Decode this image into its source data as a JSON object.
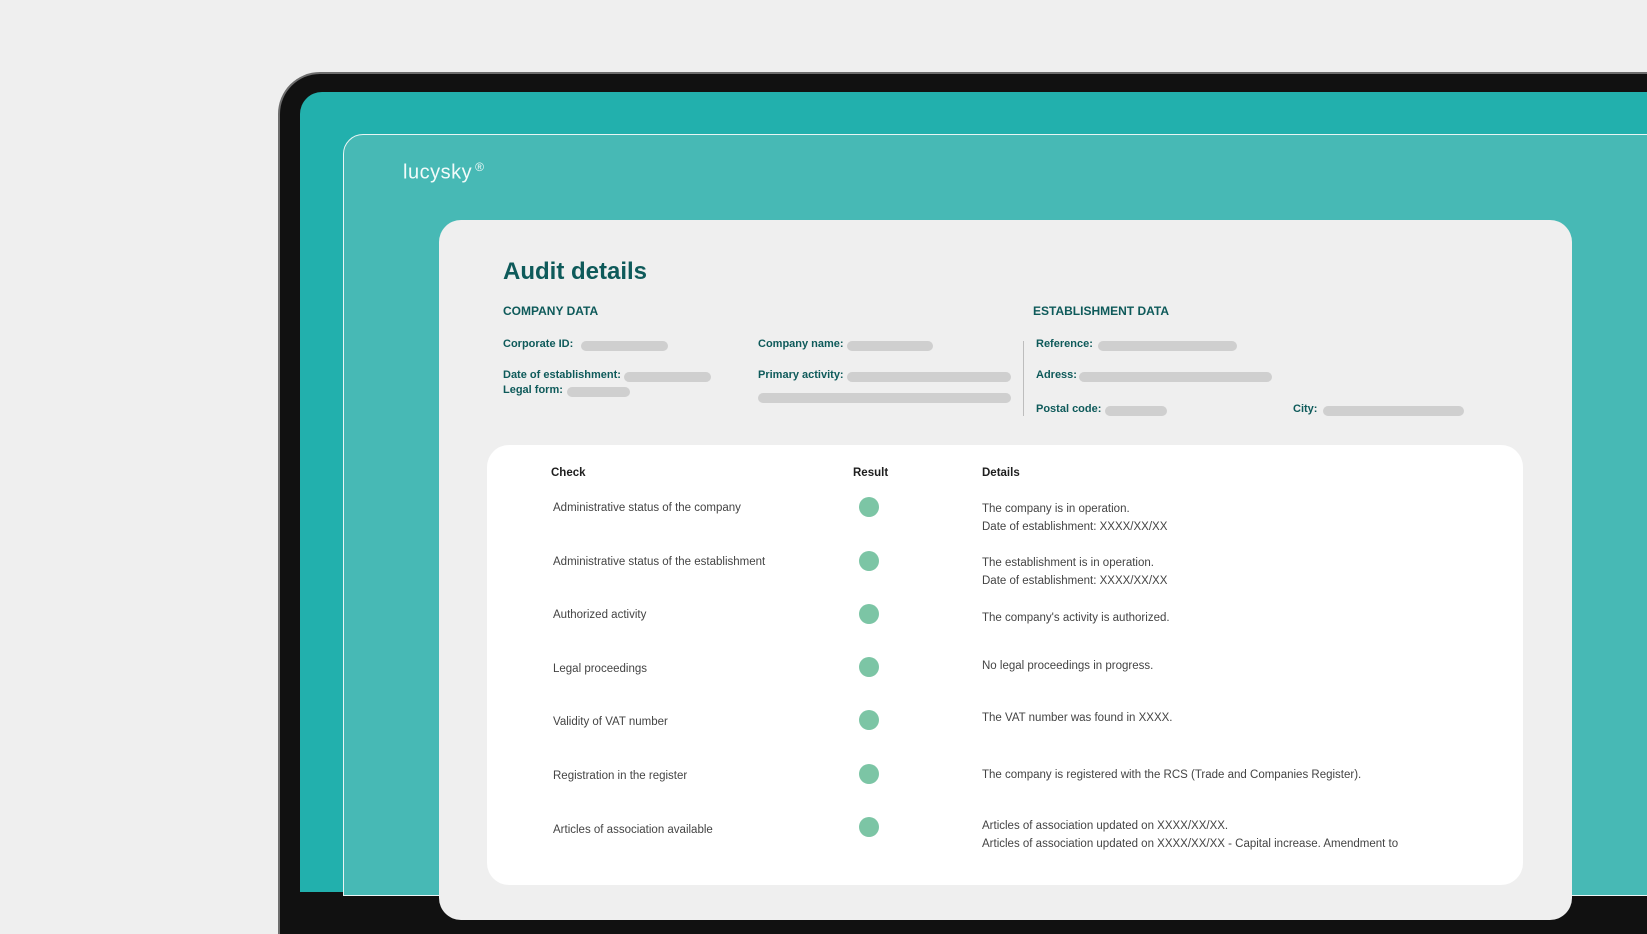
{
  "app": {
    "logo": "lucysky",
    "logo_mark": "®"
  },
  "page": {
    "title": "Audit details"
  },
  "company_data": {
    "heading": "COMPANY DATA",
    "corporate_id_label": "Corporate ID:",
    "company_name_label": "Company name:",
    "date_of_establishment_label": "Date of establishment:",
    "primary_activity_label": "Primary activity:",
    "legal_form_label": "Legal form:"
  },
  "establishment_data": {
    "heading": "ESTABLISHMENT DATA",
    "reference_label": "Reference:",
    "address_label": "Adress:",
    "postal_code_label": "Postal code:",
    "city_label": "City:"
  },
  "table": {
    "headers": {
      "check": "Check",
      "result": "Result",
      "details": "Details"
    },
    "rows": [
      {
        "check": "Administrative status of the company",
        "details_1": "The company is in operation.",
        "details_2": "Date of establishment: XXXX/XX/XX"
      },
      {
        "check": "Administrative status of the establishment",
        "details_1": "The establishment is in operation.",
        "details_2": "Date of establishment: XXXX/XX/XX"
      },
      {
        "check": "Authorized activity",
        "details_1": "The company's activity is authorized.",
        "details_2": ""
      },
      {
        "check": "Legal proceedings",
        "details_1": "No legal proceedings in progress.",
        "details_2": ""
      },
      {
        "check": "Validity of VAT number",
        "details_1": "The VAT number was found in XXXX.",
        "details_2": ""
      },
      {
        "check": "Registration in the register",
        "details_1": "The company is registered with the RCS (Trade and Companies Register).",
        "details_2": ""
      },
      {
        "check": "Articles of association available",
        "details_1": "Articles of association updated on XXXX/XX/XX.",
        "details_2": "Articles of association updated on XXXX/XX/XX - Capital increase. Amendment to"
      }
    ]
  },
  "colors": {
    "accent_teal": "#22b0ad",
    "heading_teal": "#0e5a5a",
    "result_ok_green": "#7cc5a5"
  },
  "icons": {
    "result_indicator": "status-dot-icon"
  }
}
